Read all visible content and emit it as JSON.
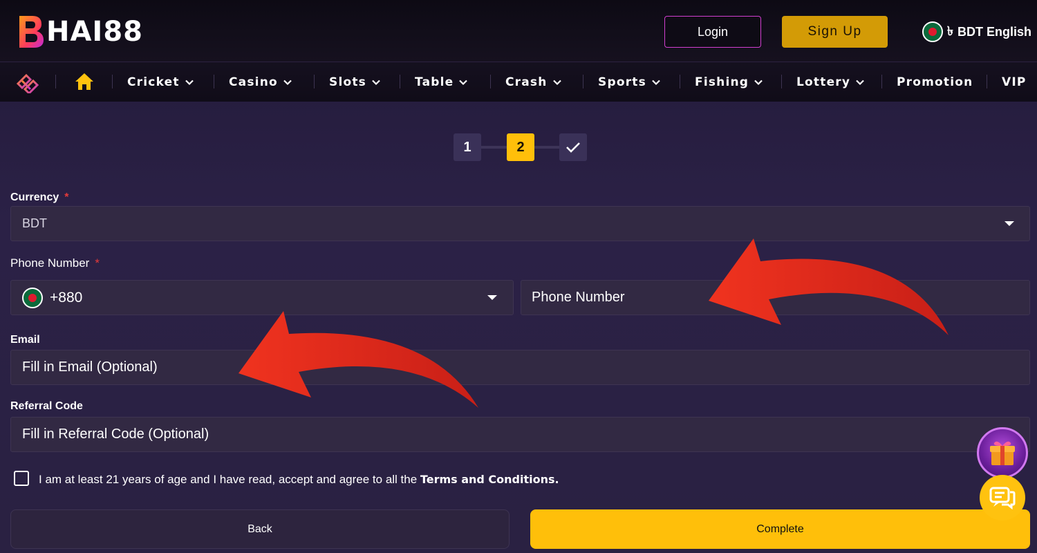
{
  "header": {
    "logo_text": "HAI88",
    "login_label": "Login",
    "signup_label": "Sign Up",
    "currency_symbol": "৳",
    "language_label": "BDT English"
  },
  "nav": {
    "items": [
      {
        "label": "Cricket",
        "has_dropdown": true
      },
      {
        "label": "Casino",
        "has_dropdown": true
      },
      {
        "label": "Slots",
        "has_dropdown": true
      },
      {
        "label": "Table",
        "has_dropdown": true
      },
      {
        "label": "Crash",
        "has_dropdown": true
      },
      {
        "label": "Sports",
        "has_dropdown": true
      },
      {
        "label": "Fishing",
        "has_dropdown": true
      },
      {
        "label": "Lottery",
        "has_dropdown": true
      },
      {
        "label": "Promotion",
        "has_dropdown": false
      },
      {
        "label": "VIP",
        "has_dropdown": false
      }
    ]
  },
  "stepper": {
    "steps": [
      "1",
      "2",
      "✓"
    ],
    "active_step": 2
  },
  "form": {
    "currency": {
      "label": "Currency",
      "required": "*",
      "value": "BDT"
    },
    "phone": {
      "label": "Phone Number",
      "required": "*",
      "country_code": "+880",
      "placeholder": "Phone Number"
    },
    "email": {
      "label": "Email",
      "placeholder": "Fill in Email (Optional)"
    },
    "referral": {
      "label": "Referral Code",
      "placeholder": "Fill in Referral Code (Optional)"
    },
    "terms": {
      "text": "I am at least 21 years of age and I have read, accept and agree to all the ",
      "link": "Terms and Conditions."
    },
    "back_label": "Back",
    "complete_label": "Complete"
  },
  "colors": {
    "accent": "#ffbf0a",
    "signup": "#d39b06",
    "login_border": "#d23fd0",
    "background": "#2a2142",
    "field_bg": "#322943",
    "annotation_arrow": "#e8281b"
  },
  "icons": [
    "logo-icon",
    "home-icon",
    "chevron-down-icon",
    "check-icon",
    "bangladesh-flag-icon",
    "caret-down-icon",
    "gift-icon",
    "chat-icon"
  ]
}
